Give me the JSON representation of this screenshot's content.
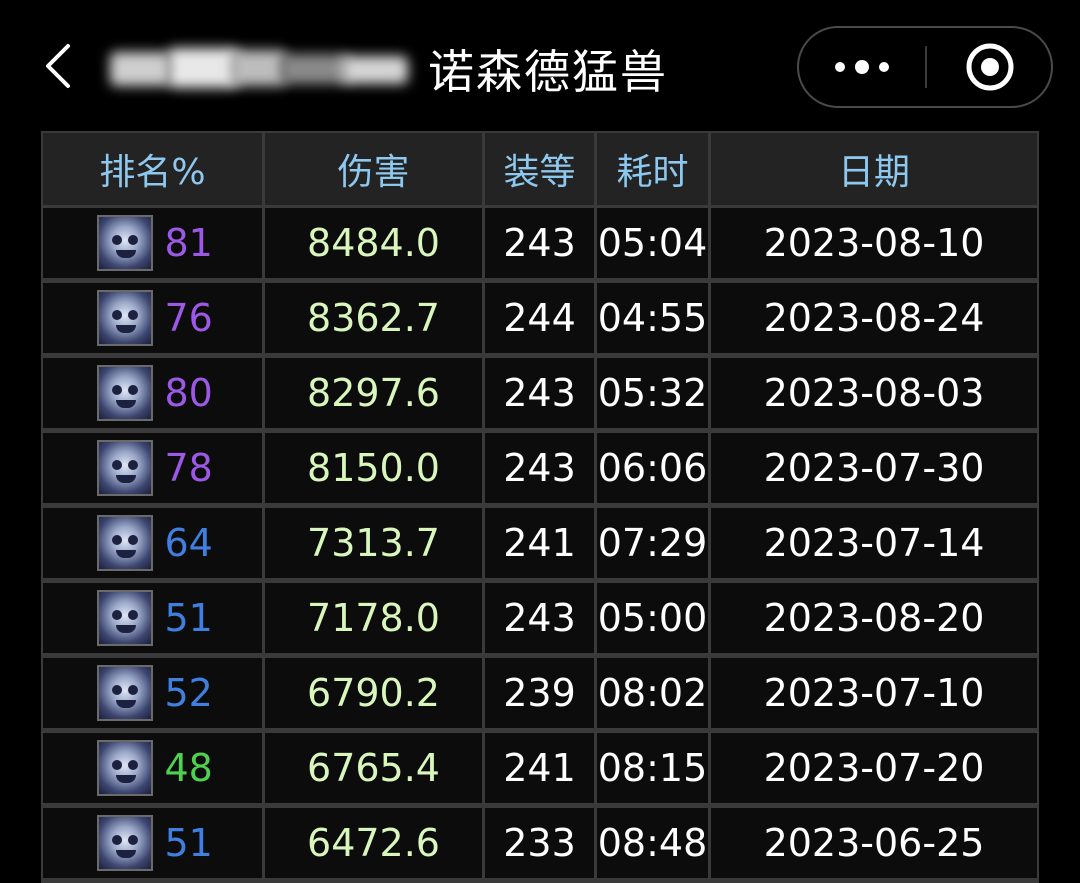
{
  "header": {
    "title": "诺森德猛兽",
    "more_icon": "more-dots-icon",
    "close_icon": "target-circle-icon",
    "back_icon": "chevron-left-icon"
  },
  "table": {
    "columns": [
      "排名%",
      "伤害",
      "装等",
      "耗时",
      "日期"
    ],
    "rows": [
      {
        "rank": "81",
        "rank_color": "#9b59e6",
        "damage": "8484.0",
        "ilvl": "243",
        "time": "05:04",
        "date": "2023-08-10"
      },
      {
        "rank": "76",
        "rank_color": "#9b59e6",
        "damage": "8362.7",
        "ilvl": "244",
        "time": "04:55",
        "date": "2023-08-24"
      },
      {
        "rank": "80",
        "rank_color": "#9b59e6",
        "damage": "8297.6",
        "ilvl": "243",
        "time": "05:32",
        "date": "2023-08-03"
      },
      {
        "rank": "78",
        "rank_color": "#9b59e6",
        "damage": "8150.0",
        "ilvl": "243",
        "time": "06:06",
        "date": "2023-07-30"
      },
      {
        "rank": "64",
        "rank_color": "#3f7fe0",
        "damage": "7313.7",
        "ilvl": "241",
        "time": "07:29",
        "date": "2023-07-14"
      },
      {
        "rank": "51",
        "rank_color": "#3f7fe0",
        "damage": "7178.0",
        "ilvl": "243",
        "time": "05:00",
        "date": "2023-08-20"
      },
      {
        "rank": "52",
        "rank_color": "#3f7fe0",
        "damage": "6790.2",
        "ilvl": "239",
        "time": "08:02",
        "date": "2023-07-10"
      },
      {
        "rank": "48",
        "rank_color": "#4ed14e",
        "damage": "6765.4",
        "ilvl": "241",
        "time": "08:15",
        "date": "2023-07-20"
      },
      {
        "rank": "51",
        "rank_color": "#3f7fe0",
        "damage": "6472.6",
        "ilvl": "233",
        "time": "08:48",
        "date": "2023-06-25"
      }
    ],
    "spec_icon": "frost-spec-icon"
  }
}
